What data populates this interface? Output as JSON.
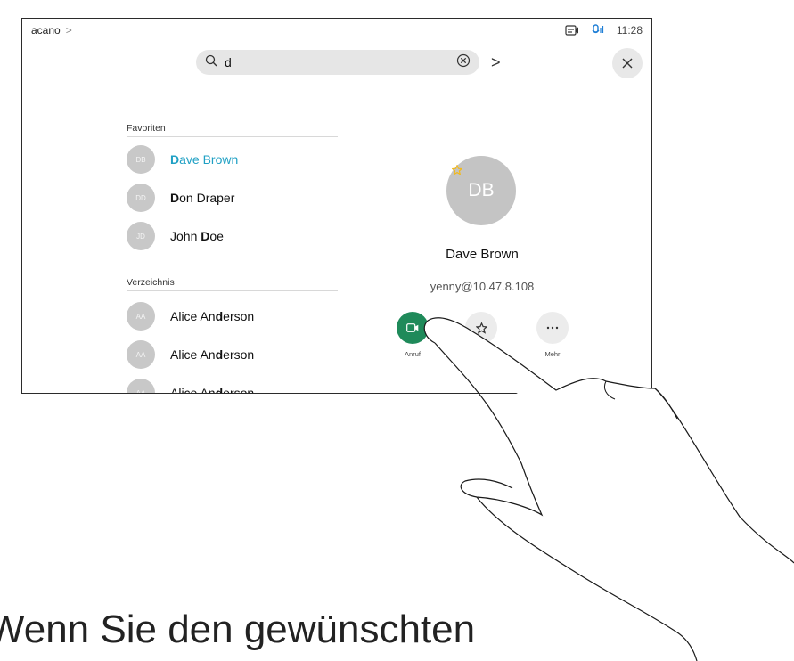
{
  "status": {
    "brand": "acano",
    "time": "11:28"
  },
  "search": {
    "query": "d"
  },
  "favorites": {
    "label": "Favoriten",
    "items": [
      {
        "initials": "DB",
        "pre": "",
        "hl": "D",
        "post": "ave Brown",
        "selected": true
      },
      {
        "initials": "DD",
        "pre": "",
        "hl": "D",
        "post": "on Draper",
        "selected": false
      },
      {
        "initials": "JD",
        "pre": "John ",
        "hl": "D",
        "post": "oe",
        "selected": false
      }
    ]
  },
  "directory": {
    "label": "Verzeichnis",
    "items": [
      {
        "initials": "AA",
        "pre": "Alice An",
        "hl": "d",
        "post": "erson"
      },
      {
        "initials": "AA",
        "pre": "Alice An",
        "hl": "d",
        "post": "erson"
      },
      {
        "initials": "AA",
        "pre": "Alice An",
        "hl": "d",
        "post": "erson"
      }
    ]
  },
  "detail": {
    "initials": "DB",
    "name": "Dave Brown",
    "uri": "yenny@10.47.8.108",
    "actions": {
      "call": "Anruf",
      "more": "Mehr"
    }
  },
  "caption": "Wenn Sie den gewünschten",
  "colors": {
    "accent": "#1fa0c4",
    "call": "#1f8a5a",
    "star": "#f2b91c"
  }
}
